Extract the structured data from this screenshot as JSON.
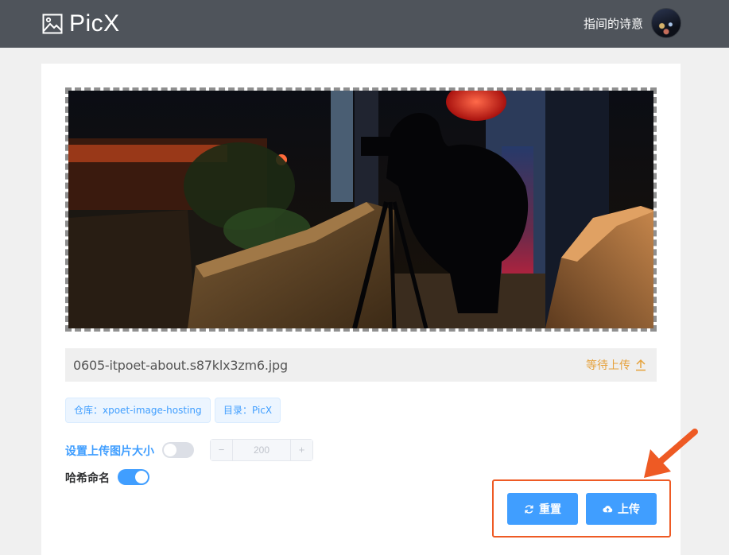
{
  "header": {
    "app_name": "PicX",
    "user_name": "指间的诗意"
  },
  "preview": {
    "file_name": "0605-itpoet-about.s87klx3zm6.jpg",
    "status": "等待上传"
  },
  "tags": {
    "repo": "仓库：xpoet-image-hosting",
    "dir": "目录：PicX"
  },
  "options": {
    "compress_label": "设置上传图片大小",
    "compress_enabled": false,
    "size_value": "200",
    "minus": "−",
    "plus": "+",
    "hash_label": "哈希命名",
    "hash_enabled": true
  },
  "actions": {
    "reset_label": "重置",
    "upload_label": "上传"
  },
  "colors": {
    "header_bg": "#4f545b",
    "accent": "#409eff",
    "pending": "#e6a23c",
    "annotation": "#ee5a24"
  }
}
